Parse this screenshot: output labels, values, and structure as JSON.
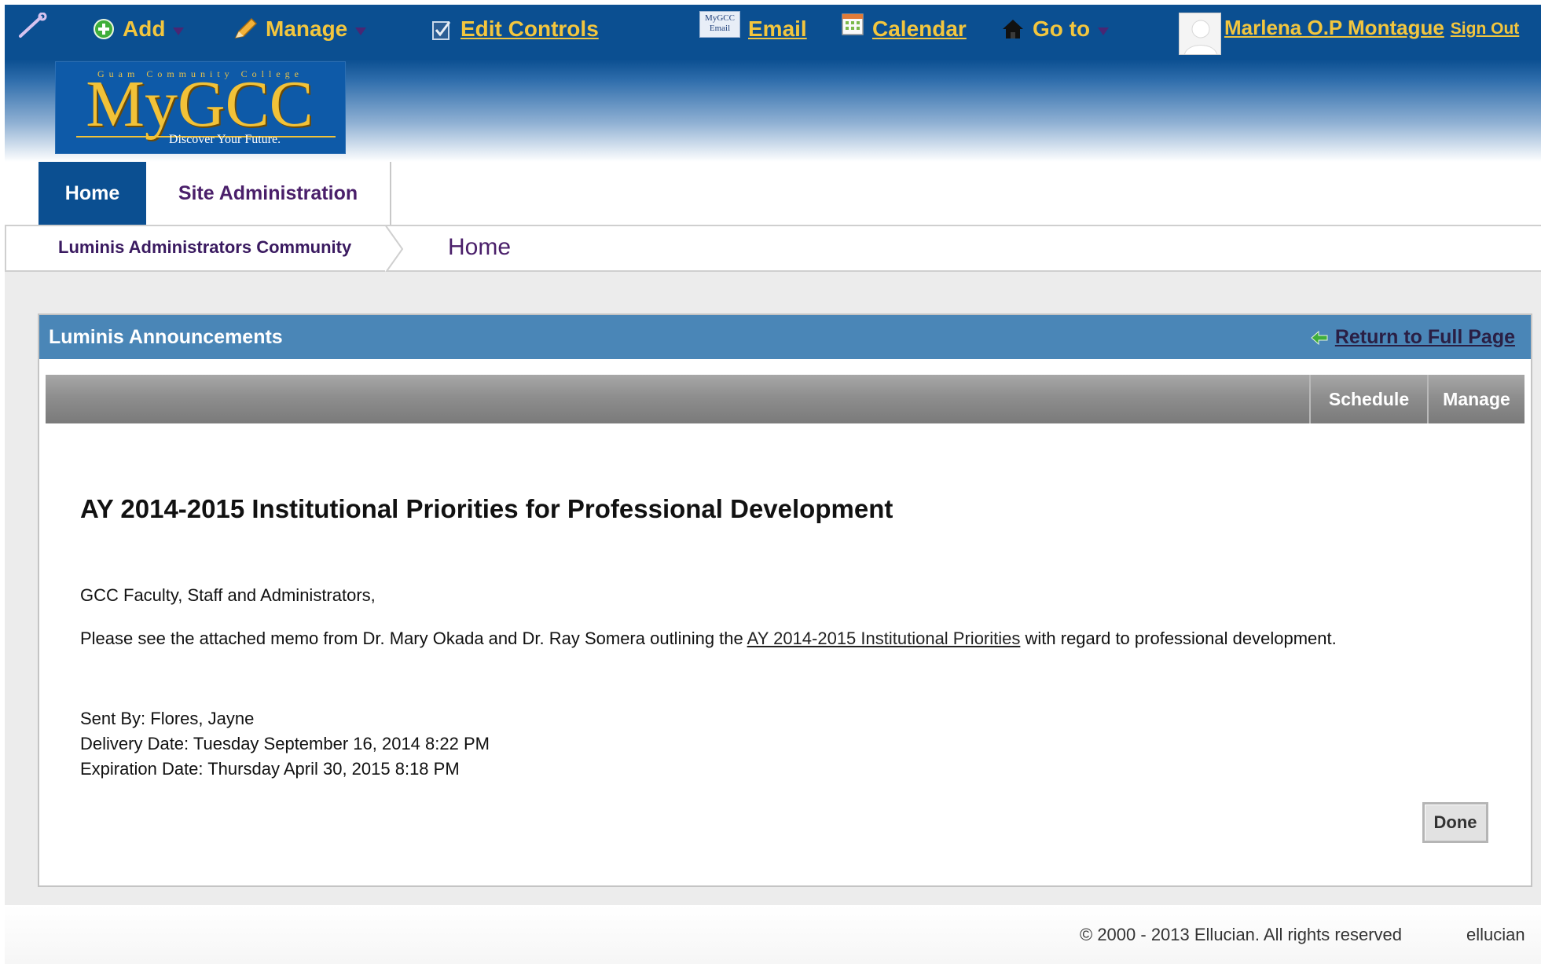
{
  "topbar": {
    "add_label": "Add",
    "manage_label": "Manage",
    "edit_controls_label": "Edit Controls",
    "email_label": "Email",
    "email_icon_text": "MyGCC Email",
    "calendar_label": "Calendar",
    "goto_label": "Go to",
    "user_name": "Marlena O.P Montague",
    "sign_out_label": "Sign Out"
  },
  "logo": {
    "small_text": "Guam Community College",
    "main_text": "MyGCC",
    "tagline": "Discover Your Future."
  },
  "nav": {
    "tabs": [
      {
        "label": "Home",
        "active": true
      },
      {
        "label": "Site Administration",
        "active": false
      }
    ]
  },
  "breadcrumb": {
    "community": "Luminis Administrators Community",
    "current": "Home"
  },
  "portlet": {
    "title": "Luminis Announcements",
    "return_label": "Return to Full Page",
    "toolbar": {
      "schedule_label": "Schedule",
      "manage_label": "Manage"
    }
  },
  "announcement": {
    "title": "AY 2014-2015 Institutional Priorities for Professional Development",
    "greeting": "GCC Faculty, Staff and Administrators,",
    "body_before": "Please see the attached memo from Dr. Mary Okada and Dr. Ray Somera outlining the ",
    "body_link": "AY 2014-2015 Institutional Priorities",
    "body_after": " with regard to professional development.",
    "sent_by": "Sent By: Flores, Jayne",
    "delivery_date": "Delivery Date: Tuesday September 16, 2014 8:22 PM",
    "expiration_date": "Expiration Date: Thursday April 30, 2015 8:18 PM",
    "done_label": "Done"
  },
  "footer": {
    "copyright": "© 2000 - 2013 Ellucian. All rights reserved",
    "brand": "ellucian"
  },
  "colors": {
    "header_blue": "#0b4f91",
    "accent_gold": "#f3c63e",
    "portlet_blue": "#4a86b7",
    "purple_text": "#4a1f6a"
  },
  "icons": [
    "wrench-icon",
    "add-icon",
    "pencil-icon",
    "checklist-icon",
    "email-icon",
    "calendar-icon",
    "house-icon",
    "avatar-icon",
    "return-arrow-icon"
  ]
}
